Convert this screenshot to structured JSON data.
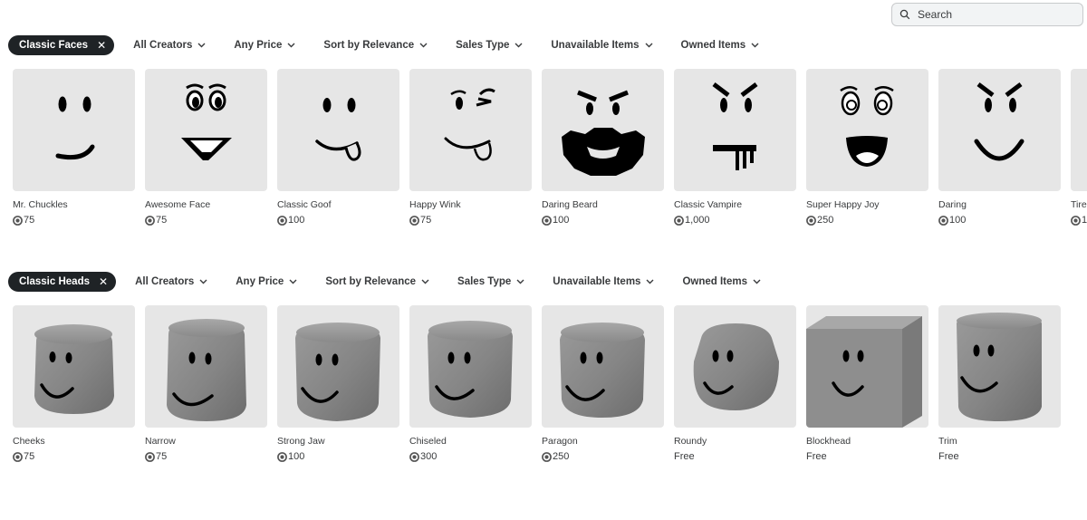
{
  "search": {
    "placeholder": "Search"
  },
  "sections": [
    {
      "chip": "Classic Faces",
      "filters": [
        "All Creators",
        "Any Price",
        "Sort by Relevance",
        "Sales Type",
        "Unavailable Items",
        "Owned Items"
      ],
      "items": [
        {
          "name": "Mr. Chuckles",
          "price": "75",
          "icon": "mr-chuckles-face-icon"
        },
        {
          "name": "Awesome Face",
          "price": "75",
          "icon": "awesome-face-icon"
        },
        {
          "name": "Classic Goof",
          "price": "100",
          "icon": "classic-goof-face-icon"
        },
        {
          "name": "Happy Wink",
          "price": "75",
          "icon": "happy-wink-face-icon"
        },
        {
          "name": "Daring Beard",
          "price": "100",
          "icon": "daring-beard-face-icon"
        },
        {
          "name": "Classic Vampire",
          "price": "1,000",
          "icon": "classic-vampire-face-icon"
        },
        {
          "name": "Super Happy Joy",
          "price": "250",
          "icon": "super-happy-joy-face-icon"
        },
        {
          "name": "Daring",
          "price": "100",
          "icon": "daring-face-icon"
        },
        {
          "name": "Tire",
          "price": "1",
          "icon": "tired-face-icon"
        }
      ]
    },
    {
      "chip": "Classic Heads",
      "filters": [
        "All Creators",
        "Any Price",
        "Sort by Relevance",
        "Sales Type",
        "Unavailable Items",
        "Owned Items"
      ],
      "items": [
        {
          "name": "Cheeks",
          "price": "75",
          "icon": "cheeks-head-icon"
        },
        {
          "name": "Narrow",
          "price": "75",
          "icon": "narrow-head-icon"
        },
        {
          "name": "Strong Jaw",
          "price": "100",
          "icon": "strong-jaw-head-icon"
        },
        {
          "name": "Chiseled",
          "price": "300",
          "icon": "chiseled-head-icon"
        },
        {
          "name": "Paragon",
          "price": "250",
          "icon": "paragon-head-icon"
        },
        {
          "name": "Roundy",
          "price": "Free",
          "icon": "roundy-head-icon"
        },
        {
          "name": "Blockhead",
          "price": "Free",
          "icon": "blockhead-head-icon"
        },
        {
          "name": "Trim",
          "price": "Free",
          "icon": "trim-head-icon"
        }
      ]
    }
  ]
}
